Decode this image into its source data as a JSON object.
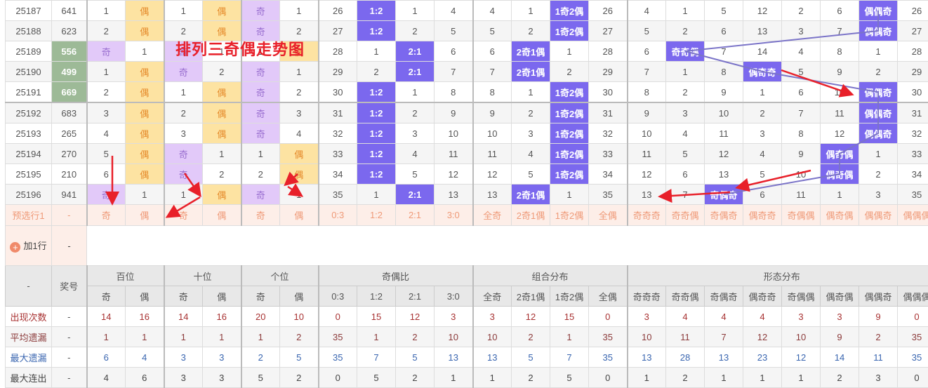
{
  "annotation_title": "排列三奇偶走势图",
  "columns": [
    "奇",
    "偶",
    "奇",
    "偶",
    "奇",
    "偶",
    "0:3",
    "1:2",
    "2:1",
    "3:0",
    "全奇",
    "2奇1偶",
    "1奇2偶",
    "全偶",
    "奇奇奇",
    "奇奇偶",
    "奇偶奇",
    "偶奇奇",
    "奇偶偶",
    "偶奇偶",
    "偶偶奇",
    "偶偶偶"
  ],
  "header": {
    "corner": "-",
    "award": "奖号",
    "groups": [
      "百位",
      "十位",
      "个位",
      "奇偶比",
      "组合分布",
      "形态分布"
    ]
  },
  "rows": [
    {
      "issue": "25187",
      "award": "641",
      "hl": false,
      "cells": [
        "1",
        "偶",
        "1",
        "偶",
        "奇",
        "1",
        "26",
        "1:2",
        "1",
        "4",
        "4",
        "1",
        "1奇2偶",
        "26",
        "4",
        "1",
        "5",
        "12",
        "2",
        "6",
        "偶偶奇",
        "26"
      ]
    },
    {
      "issue": "25188",
      "award": "623",
      "hl": false,
      "cells": [
        "2",
        "偶",
        "2",
        "偶",
        "奇",
        "2",
        "27",
        "1:2",
        "2",
        "5",
        "5",
        "2",
        "1奇2偶",
        "27",
        "5",
        "2",
        "6",
        "13",
        "3",
        "7",
        "偶偶奇",
        "27"
      ]
    },
    {
      "issue": "25189",
      "award": "556",
      "hl": true,
      "cells": [
        "奇",
        "1",
        "奇",
        "1",
        "1",
        "偶",
        "28",
        "1",
        "2:1",
        "6",
        "6",
        "2奇1偶",
        "1",
        "28",
        "6",
        "奇奇偶",
        "7",
        "14",
        "4",
        "8",
        "1",
        "28"
      ]
    },
    {
      "issue": "25190",
      "award": "499",
      "hl": true,
      "cells": [
        "1",
        "偶",
        "奇",
        "2",
        "奇",
        "1",
        "29",
        "2",
        "2:1",
        "7",
        "7",
        "2奇1偶",
        "2",
        "29",
        "7",
        "1",
        "8",
        "偶奇奇",
        "5",
        "9",
        "2",
        "29"
      ]
    },
    {
      "issue": "25191",
      "award": "669",
      "hl": true,
      "cells": [
        "2",
        "偶",
        "1",
        "偶",
        "奇",
        "2",
        "30",
        "1:2",
        "1",
        "8",
        "8",
        "1",
        "1奇2偶",
        "30",
        "8",
        "2",
        "9",
        "1",
        "6",
        "10",
        "偶偶奇",
        "30"
      ]
    },
    {
      "issue": "25192",
      "award": "683",
      "hl": false,
      "cells": [
        "3",
        "偶",
        "2",
        "偶",
        "奇",
        "3",
        "31",
        "1:2",
        "2",
        "9",
        "9",
        "2",
        "1奇2偶",
        "31",
        "9",
        "3",
        "10",
        "2",
        "7",
        "11",
        "偶偶奇",
        "31"
      ]
    },
    {
      "issue": "25193",
      "award": "265",
      "hl": false,
      "cells": [
        "4",
        "偶",
        "3",
        "偶",
        "奇",
        "4",
        "32",
        "1:2",
        "3",
        "10",
        "10",
        "3",
        "1奇2偶",
        "32",
        "10",
        "4",
        "11",
        "3",
        "8",
        "12",
        "偶偶奇",
        "32"
      ]
    },
    {
      "issue": "25194",
      "award": "270",
      "hl": false,
      "cells": [
        "5",
        "偶",
        "奇",
        "1",
        "1",
        "偶",
        "33",
        "1:2",
        "4",
        "11",
        "11",
        "4",
        "1奇2偶",
        "33",
        "11",
        "5",
        "12",
        "4",
        "9",
        "偶奇偶",
        "1",
        "33"
      ]
    },
    {
      "issue": "25195",
      "award": "210",
      "hl": false,
      "cells": [
        "6",
        "偶",
        "奇",
        "2",
        "2",
        "偶",
        "34",
        "1:2",
        "5",
        "12",
        "12",
        "5",
        "1奇2偶",
        "34",
        "12",
        "6",
        "13",
        "5",
        "10",
        "偶奇偶",
        "2",
        "34"
      ]
    },
    {
      "issue": "25196",
      "award": "941",
      "hl": false,
      "cells": [
        "奇",
        "1",
        "1",
        "偶",
        "奇",
        "1",
        "35",
        "1",
        "2:1",
        "13",
        "13",
        "2奇1偶",
        "1",
        "35",
        "13",
        "7",
        "奇偶奇",
        "6",
        "11",
        "1",
        "3",
        "35"
      ]
    }
  ],
  "preselect": {
    "label": "预选行1",
    "award": "-"
  },
  "add_row": {
    "label": "加1行",
    "award": "-",
    "icon": "plus-circle-icon"
  },
  "stats": [
    {
      "label": "出现次数",
      "award": "-",
      "values": [
        "14",
        "16",
        "14",
        "16",
        "20",
        "10",
        "0",
        "15",
        "12",
        "3",
        "3",
        "12",
        "15",
        "0",
        "3",
        "4",
        "4",
        "4",
        "3",
        "3",
        "9",
        "0"
      ]
    },
    {
      "label": "平均遗漏",
      "award": "-",
      "values": [
        "1",
        "1",
        "1",
        "1",
        "1",
        "2",
        "35",
        "1",
        "2",
        "10",
        "10",
        "2",
        "1",
        "35",
        "10",
        "11",
        "7",
        "12",
        "10",
        "9",
        "2",
        "35"
      ]
    },
    {
      "label": "最大遗漏",
      "award": "-",
      "values": [
        "6",
        "4",
        "3",
        "3",
        "2",
        "5",
        "35",
        "7",
        "5",
        "13",
        "13",
        "5",
        "7",
        "35",
        "13",
        "28",
        "13",
        "23",
        "12",
        "14",
        "11",
        "35"
      ]
    },
    {
      "label": "最大连出",
      "award": "-",
      "values": [
        "4",
        "6",
        "3",
        "3",
        "5",
        "2",
        "0",
        "5",
        "2",
        "1",
        "1",
        "2",
        "5",
        "0",
        "1",
        "2",
        "1",
        "1",
        "1",
        "2",
        "3",
        "0"
      ]
    }
  ],
  "colors": {
    "odd_bg": "#e2c9f9",
    "even_bg": "#fde3a2",
    "block": "#7b68ee",
    "award_hl": "#9dba97",
    "arrow": "#e8202a",
    "trend_line": "#7b74c8"
  }
}
